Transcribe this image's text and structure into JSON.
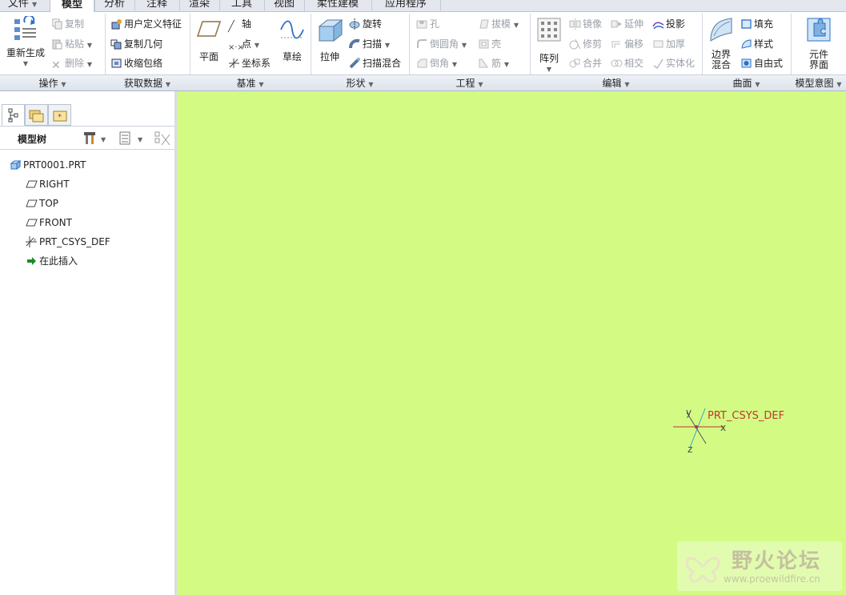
{
  "menubar": {
    "tabs": [
      {
        "label": "文件",
        "dropdown": true
      },
      {
        "label": "模型"
      },
      {
        "label": "分析"
      },
      {
        "label": "注释"
      },
      {
        "label": "渲染"
      },
      {
        "label": "工具"
      },
      {
        "label": "视图"
      },
      {
        "label": "柔性建模"
      },
      {
        "label": "应用程序"
      }
    ],
    "active": "模型"
  },
  "ribbon": {
    "operations": {
      "label": "操作",
      "regenerate": "重新生成",
      "copy": "复制",
      "paste": "粘贴",
      "delete": "删除"
    },
    "get_data": {
      "label": "获取数据",
      "udf": "用户定义特征",
      "copy_geom": "复制几何",
      "shrinkwrap": "收缩包络"
    },
    "datum": {
      "label": "基准",
      "plane": "平面",
      "axis": "轴",
      "point": "点",
      "csys": "坐标系",
      "sketch": "草绘"
    },
    "shapes": {
      "label": "形状",
      "extrude": "拉伸",
      "revolve": "旋转",
      "sweep": "扫描",
      "swept_blend": "扫描混合"
    },
    "engineering": {
      "label": "工程",
      "hole": "孔",
      "round": "倒圆角",
      "chamfer": "倒角",
      "draft": "拔模",
      "shell": "壳",
      "rib": "筋"
    },
    "editing": {
      "label": "编辑",
      "pattern": "阵列",
      "mirror": "镜像",
      "trim": "修剪",
      "merge": "合并",
      "extend": "延伸",
      "offset": "偏移",
      "intersect": "相交",
      "project": "投影",
      "thicken": "加厚",
      "solidify": "实体化"
    },
    "surfaces": {
      "label": "曲面",
      "boundary_blend": "边界混合",
      "fill": "填充",
      "style": "样式",
      "freestyle": "自由式"
    },
    "model_intent": {
      "label": "模型意图",
      "component_interface": "元件界面"
    }
  },
  "model_tree": {
    "header": "模型树",
    "items": [
      {
        "label": "PRT0001.PRT",
        "icon": "part-icon"
      },
      {
        "label": "RIGHT",
        "icon": "datum-plane-icon"
      },
      {
        "label": "TOP",
        "icon": "datum-plane-icon"
      },
      {
        "label": "FRONT",
        "icon": "datum-plane-icon"
      },
      {
        "label": "PRT_CSYS_DEF",
        "icon": "csys-icon"
      },
      {
        "label": "在此插入",
        "icon": "insert-arrow-icon"
      }
    ]
  },
  "graphics": {
    "background": "#d3fb84",
    "csys_label": "PRT_CSYS_DEF",
    "axis_x": "x",
    "axis_y": "y",
    "axis_z": "z"
  },
  "watermark": {
    "title": "野火论坛",
    "url": "www.proewildfire.cn"
  }
}
